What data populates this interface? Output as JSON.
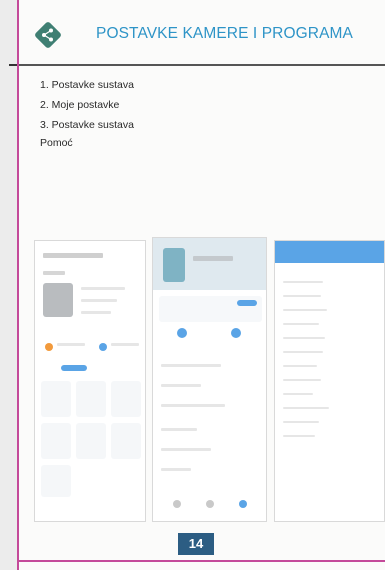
{
  "header": {
    "title": "POSTAVKE KAMERE I PROGRAMA"
  },
  "list": {
    "item1": "1. Postavke sustava",
    "item2": "2. Moje postavke",
    "item3": "3. Postavke sustava",
    "help": "Pomoć"
  },
  "footer": {
    "page_number": "14"
  },
  "colors": {
    "title": "#2e94c7",
    "rule_magenta": "#c44a9a",
    "page_badge": "#2c5d83",
    "accent_blue": "#5aa4e6",
    "accent_orange": "#f29a3c"
  }
}
